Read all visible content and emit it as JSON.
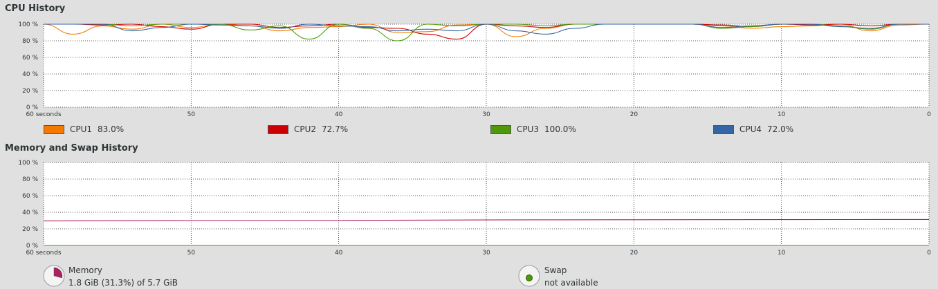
{
  "cpu": {
    "title": "CPU History",
    "y_ticks": [
      "0 %",
      "20 %",
      "40 %",
      "60 %",
      "80 %",
      "100 %"
    ],
    "x_ticks": [
      "60 seconds",
      "50",
      "40",
      "30",
      "20",
      "10",
      "0"
    ],
    "legend": [
      {
        "name": "CPU1",
        "value": "83.0%",
        "color": "#f57900"
      },
      {
        "name": "CPU2",
        "value": "72.7%",
        "color": "#cc0000"
      },
      {
        "name": "CPU3",
        "value": "100.0%",
        "color": "#4e9a06"
      },
      {
        "name": "CPU4",
        "value": "72.0%",
        "color": "#3465a4"
      }
    ]
  },
  "memory": {
    "title": "Memory and Swap History",
    "y_ticks": [
      "0 %",
      "20 %",
      "40 %",
      "60 %",
      "80 %",
      "100 %"
    ],
    "x_ticks": [
      "60 seconds",
      "50",
      "40",
      "30",
      "20",
      "10",
      "0"
    ],
    "memory_label": "Memory",
    "memory_value": "1.8 GiB (31.3%) of 5.7 GiB",
    "memory_color": "#ad1f5e",
    "swap_label": "Swap",
    "swap_value": "not available",
    "swap_color": "#4e9a06"
  },
  "chart_data": [
    {
      "type": "line",
      "title": "CPU History",
      "xlabel": "seconds",
      "ylabel": "",
      "x": [
        60,
        58,
        56,
        54,
        52,
        50,
        48,
        46,
        44,
        42,
        40,
        38,
        36,
        34,
        32,
        30,
        28,
        26,
        24,
        22,
        20,
        18,
        16,
        14,
        12,
        10,
        8,
        6,
        4,
        2,
        0
      ],
      "xlim": [
        60,
        0
      ],
      "ylim": [
        0,
        100
      ],
      "series": [
        {
          "name": "CPU1",
          "color": "#f57900",
          "values": [
            100,
            88,
            98,
            94,
            100,
            96,
            100,
            98,
            92,
            96,
            97,
            100,
            90,
            91,
            99,
            100,
            85,
            95,
            100,
            100,
            100,
            100,
            100,
            98,
            95,
            97,
            98,
            100,
            92,
            99,
            100
          ]
        },
        {
          "name": "CPU2",
          "color": "#cc0000",
          "values": [
            100,
            100,
            99,
            100,
            97,
            94,
            100,
            100,
            96,
            98,
            100,
            96,
            95,
            88,
            82,
            100,
            98,
            96,
            100,
            100,
            100,
            100,
            100,
            99,
            97,
            100,
            99,
            100,
            98,
            100,
            100
          ]
        },
        {
          "name": "CPU3",
          "color": "#4e9a06",
          "values": [
            100,
            100,
            100,
            98,
            100,
            100,
            100,
            93,
            98,
            82,
            100,
            95,
            80,
            100,
            98,
            100,
            100,
            98,
            100,
            100,
            100,
            100,
            100,
            95,
            97,
            100,
            100,
            98,
            94,
            100,
            100
          ]
        },
        {
          "name": "CPU4",
          "color": "#3465a4",
          "values": [
            100,
            100,
            100,
            92,
            96,
            100,
            99,
            98,
            95,
            100,
            98,
            97,
            92,
            94,
            92,
            100,
            92,
            88,
            95,
            100,
            100,
            100,
            100,
            96,
            98,
            100,
            100,
            97,
            95,
            100,
            100
          ]
        }
      ]
    },
    {
      "type": "line",
      "title": "Memory and Swap History",
      "xlabel": "seconds",
      "ylabel": "",
      "x": [
        60,
        50,
        40,
        30,
        20,
        10,
        0
      ],
      "xlim": [
        60,
        0
      ],
      "ylim": [
        0,
        100
      ],
      "series": [
        {
          "name": "Memory",
          "color": "#ad1f5e",
          "values": [
            29.5,
            30,
            30.2,
            30.8,
            31,
            31.2,
            31.3
          ]
        },
        {
          "name": "Swap",
          "color": "#4e9a06",
          "values": [
            0,
            0,
            0,
            0,
            0,
            0,
            0
          ]
        }
      ]
    }
  ]
}
